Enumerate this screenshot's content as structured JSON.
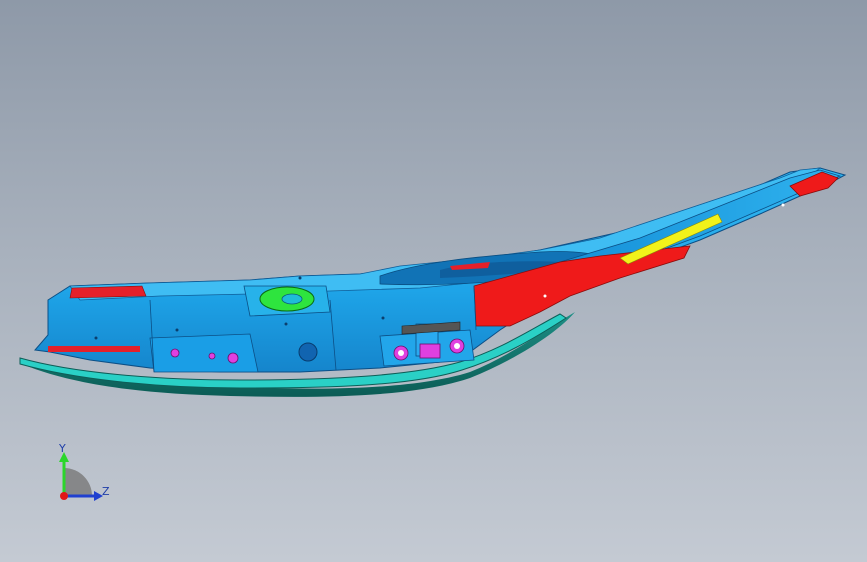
{
  "viewport": {
    "background_top": "#8e99a8",
    "background_bottom": "#c4cad3"
  },
  "model": {
    "part_colors": {
      "body": "#1ea8ec",
      "body_dark": "#1172b8",
      "trim": "#22c7c0",
      "underside": "#0e6f66",
      "red_panel": "#f01818",
      "yellow_strip": "#f2f21a",
      "green_feature": "#28e33c",
      "magenta_holes": "#e040e0"
    }
  },
  "triad": {
    "y_label": "Y",
    "z_label": "Z",
    "y_color": "#2bd62b",
    "z_color": "#2040d0",
    "origin_color": "#e01818"
  }
}
